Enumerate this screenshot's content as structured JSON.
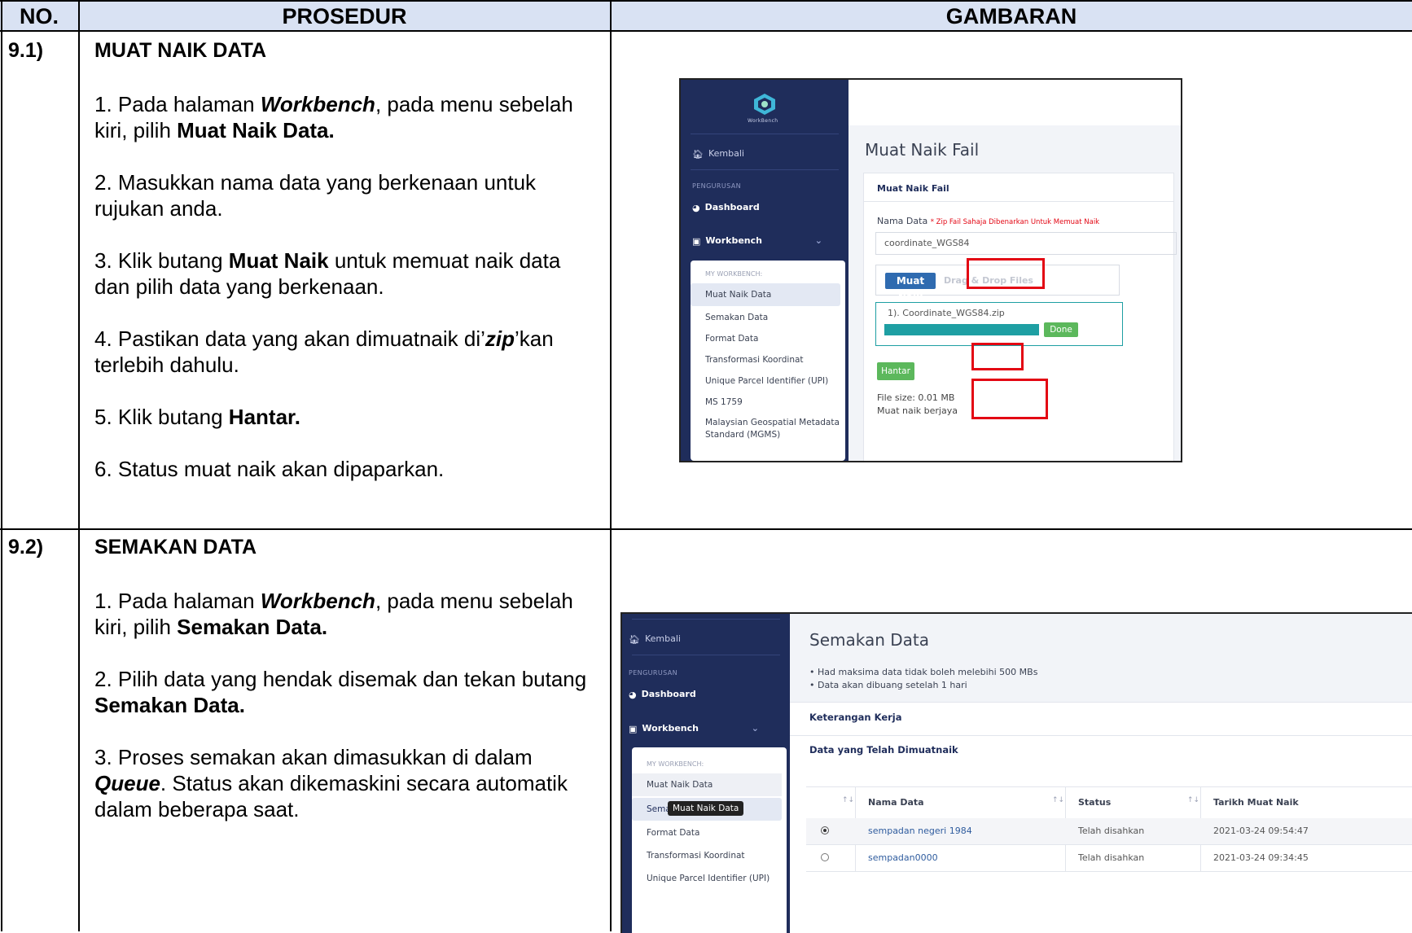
{
  "table": {
    "headers": {
      "no": "NO.",
      "prosedur": "PROSEDUR",
      "gambaran": "GAMBARAN"
    },
    "sections": [
      {
        "number": "9.1)",
        "title": "MUAT NAIK DATA",
        "steps": [
          {
            "num": "1. ",
            "t1": "Pada halaman ",
            "em": "Workbench",
            "t2": ", pada menu sebelah kiri, pilih ",
            "bold": "Muat Naik Data.",
            "t3": ""
          },
          {
            "num": "2. ",
            "t1": "Masukkan nama data yang berkenaan untuk rujukan anda.",
            "em": "",
            "t2": "",
            "bold": "",
            "t3": ""
          },
          {
            "num": "3. ",
            "t1": "Klik butang ",
            "em": "",
            "t2": "",
            "bold": "Muat Naik",
            "t3": " untuk memuat naik data dan pilih data yang berkenaan."
          },
          {
            "num": "4. ",
            "t1": "Pastikan data yang akan dimuatnaik di’",
            "em": "zip",
            "t2": "’kan terlebih dahulu.",
            "bold": "",
            "t3": ""
          },
          {
            "num": "5. ",
            "t1": "Klik butang ",
            "em": "",
            "t2": "",
            "bold": "Hantar.",
            "t3": ""
          },
          {
            "num": "6. ",
            "t1": "Status muat naik akan dipaparkan.",
            "em": "",
            "t2": "",
            "bold": "",
            "t3": ""
          }
        ]
      },
      {
        "number": "9.2)",
        "title": "SEMAKAN DATA",
        "steps": [
          {
            "num": "1. ",
            "t1": "Pada halaman ",
            "em": "Workbench",
            "t2": ", pada menu sebelah kiri, pilih ",
            "bold": "Semakan Data.",
            "t3": ""
          },
          {
            "num": "2. ",
            "t1": "Pilih data yang hendak disemak dan tekan butang ",
            "em": "",
            "t2": "",
            "bold": "Semakan Data.",
            "t3": ""
          },
          {
            "num": "3. ",
            "t1": "Proses semakan akan dimasukkan di dalam ",
            "em": "Queue",
            "t2": ". Status akan dikemaskini secara automatik dalam beberapa saat.",
            "bold": "",
            "t3": ""
          }
        ]
      }
    ]
  },
  "shot1": {
    "logo_text": "WorkBench",
    "sidebar": {
      "back": "Kembali",
      "section": "PENGURUSAN",
      "dashboard": "Dashboard",
      "workbench": "Workbench",
      "submenu_header": "MY WORKBENCH:",
      "submenu": [
        "Muat Naik Data",
        "Semakan Data",
        "Format Data",
        "Transformasi Koordinat",
        "Unique Parcel Identifier (UPI)",
        "MS 1759",
        "Malaysian Geospatial Metadata Standard (MGMS)"
      ]
    },
    "page_title": "Muat Naik Fail",
    "card_title": "Muat Naik Fail",
    "field_label": "Nama Data",
    "field_note": "* Zip Fail Sahaja Dibenarkan Untuk Memuat Naik",
    "field_value": "coordinate_WGS84",
    "upload_button": "Muat Naik",
    "drop_text": "Drag & Drop Files",
    "file_item": "1). Coordinate_WGS84.zip",
    "progress": 1.0,
    "done_label": "Done",
    "submit_button": "Hantar",
    "status_size": "File size: 0.01 MB",
    "status_text": "Muat naik berjaya",
    "colors": {
      "sidebar": "#1f2d5b",
      "accent_blue": "#2f6bb0",
      "accent_teal": "#1e9fa3",
      "accent_green": "#5cb85c",
      "highlight_red": "#e30613"
    }
  },
  "shot2": {
    "sidebar": {
      "back": "Kembali",
      "section": "PENGURUSAN",
      "dashboard": "Dashboard",
      "workbench": "Workbench",
      "submenu_header": "MY WORKBENCH:",
      "submenu": [
        "Muat Naik Data",
        "Semak",
        "Format Data",
        "Transformasi Koordinat",
        "Unique Parcel Identifier (UPI)"
      ],
      "tooltip": "Muat Naik Data"
    },
    "page_title": "Semakan Data",
    "notes": [
      "Had maksima data tidak boleh melebihi 500 MBs",
      "Data akan dibuang setelah 1 hari"
    ],
    "panel_title": "Keterangan Kerja",
    "list_title": "Data yang Telah Dimuatnaik",
    "columns": [
      "Nama Data",
      "Status",
      "Tarikh Muat Naik"
    ],
    "rows": [
      {
        "selected": true,
        "name": "sempadan negeri 1984",
        "status": "Telah disahkan",
        "date": "2021-03-24 09:54:47"
      },
      {
        "selected": false,
        "name": "sempadan0000",
        "status": "Telah disahkan",
        "date": "2021-03-24 09:34:45"
      }
    ]
  }
}
